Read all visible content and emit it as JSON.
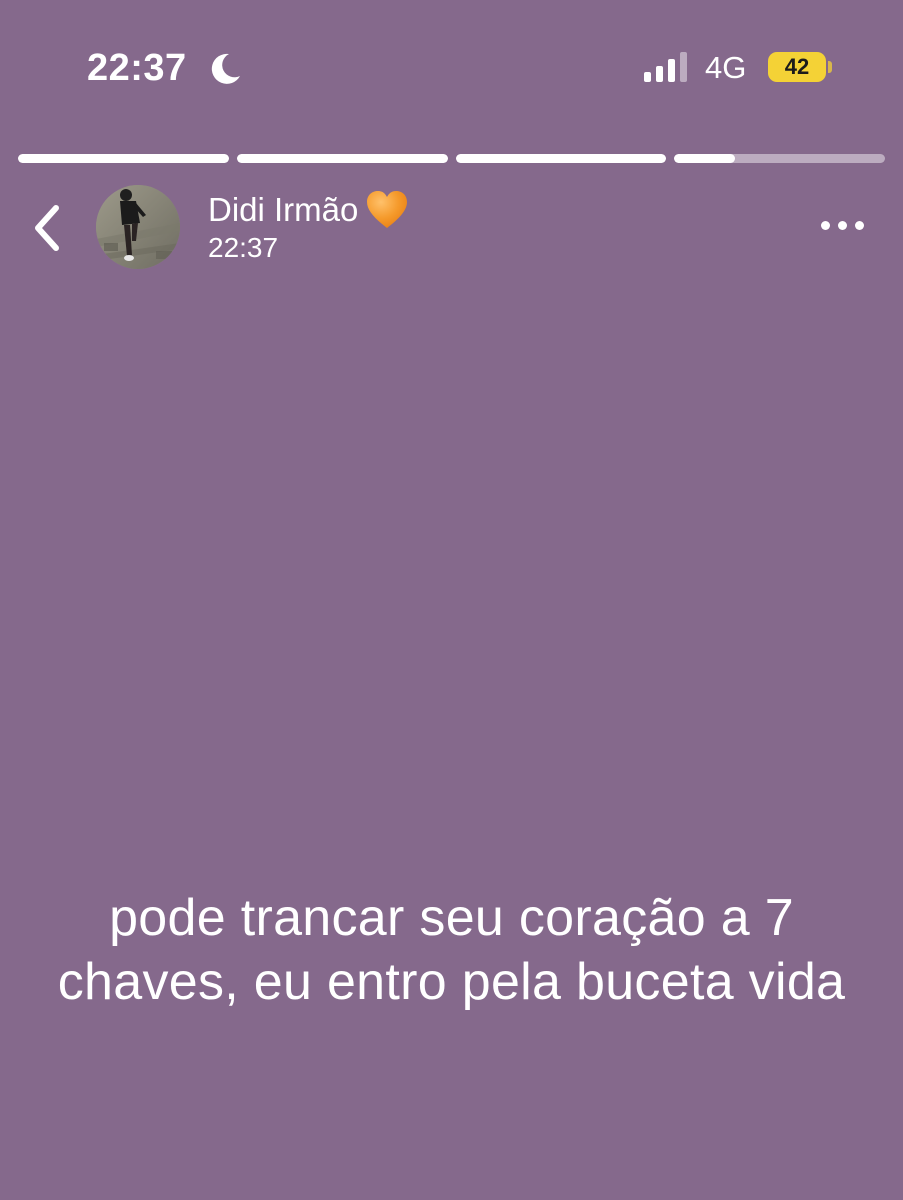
{
  "status_bar": {
    "time": "22:37",
    "moon_icon": "moon-icon",
    "signal_icon": "cellular-signal-icon",
    "network": "4G",
    "battery": "42",
    "battery_color": "#f4d236"
  },
  "story_progress": {
    "segments": [
      {
        "fill": 1.0
      },
      {
        "fill": 1.0
      },
      {
        "fill": 1.0
      },
      {
        "fill": 0.29
      }
    ]
  },
  "header": {
    "back_icon": "chevron-left-icon",
    "contact_name": "Didi Irmão",
    "name_emoji_icon": "orange-heart-icon",
    "timestamp": "22:37",
    "more_icon": "more-horizontal-icon"
  },
  "status": {
    "text": "pode trancar seu coração a 7 chaves, eu entro pela buceta vida",
    "background_color": "#85698c",
    "text_color": "#ffffff"
  }
}
